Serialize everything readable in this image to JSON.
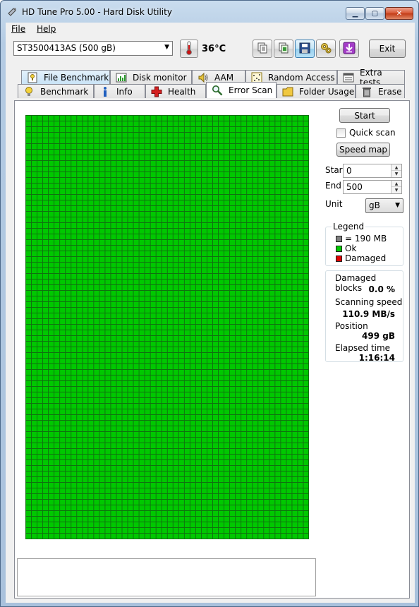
{
  "window": {
    "title": "HD Tune Pro 5.00 - Hard Disk Utility",
    "colors": {
      "scan_ok": "#00c800",
      "scan_damaged": "#e00000",
      "legend_block": "#808080"
    }
  },
  "menu": [
    {
      "label": "File"
    },
    {
      "label": "Help"
    }
  ],
  "toolbar": {
    "drive": "ST3500413AS (500 gB)",
    "temperature": "36°C",
    "exit_label": "Exit",
    "icons": [
      "copy-text-icon",
      "copy-screenshot-icon",
      "save-icon",
      "options-icon",
      "download-icon"
    ]
  },
  "tabs": {
    "row1": [
      {
        "label": "File Benchmark",
        "icon": "file-benchmark-icon"
      },
      {
        "label": "Disk monitor",
        "icon": "disk-monitor-icon"
      },
      {
        "label": "AAM",
        "icon": "speaker-icon"
      },
      {
        "label": "Random Access",
        "icon": "random-access-icon"
      },
      {
        "label": "Extra tests",
        "icon": "extra-tests-icon"
      }
    ],
    "row2": [
      {
        "label": "Benchmark",
        "icon": "lightbulb-icon"
      },
      {
        "label": "Info",
        "icon": "info-icon"
      },
      {
        "label": "Health",
        "icon": "health-cross-icon"
      },
      {
        "label": "Error Scan",
        "icon": "magnifier-icon"
      },
      {
        "label": "Folder Usage",
        "icon": "folder-icon"
      },
      {
        "label": "Erase",
        "icon": "trash-icon"
      }
    ],
    "selected": "Error Scan"
  },
  "error_scan": {
    "start_button": "Start",
    "quick_scan_label": "Quick scan",
    "quick_scan_checked": false,
    "speed_map_button": "Speed map",
    "start_label": "Start",
    "start_value": "0",
    "end_label": "End",
    "end_value": "500",
    "unit_label": "Unit",
    "unit_value": "gB",
    "legend": {
      "title": "Legend",
      "block": "= 190 MB",
      "ok": "Ok",
      "damaged": "Damaged"
    },
    "stats": {
      "damaged_blocks_label": "Damaged blocks",
      "damaged_blocks_value": "0.0 %",
      "scanning_speed_label": "Scanning speed",
      "scanning_speed_value": "110.9 MB/s",
      "position_label": "Position",
      "position_value": "499 gB",
      "elapsed_label": "Elapsed time",
      "elapsed_value": "1:16:14"
    },
    "scan_result": "all blocks ok",
    "log_text": ""
  }
}
